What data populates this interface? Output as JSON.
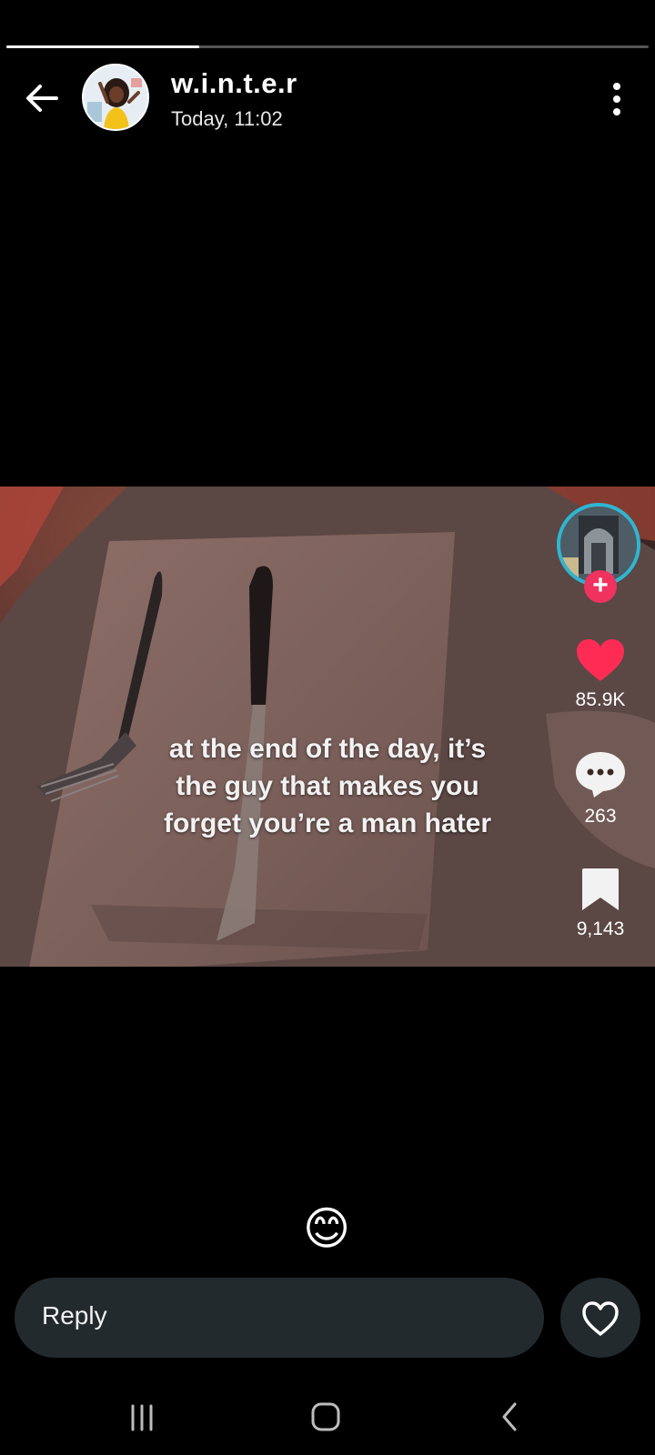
{
  "story": {
    "progress": 0.3
  },
  "header": {
    "username": "w.i.n.t.e.r",
    "timestamp": "Today, 11:02"
  },
  "media": {
    "caption_lines": [
      "at the end of the day, it’s",
      "the guy that makes you",
      "forget you’re a man hater"
    ],
    "likes": "85.9K",
    "comments": "263",
    "saves": "9,143",
    "follow_symbol": "+"
  },
  "reaction": {
    "emoji": "😊"
  },
  "reply": {
    "placeholder": "Reply"
  },
  "colors": {
    "background": "#000000",
    "reply_field": "#232a2e",
    "like_heart": "#fe2c55",
    "follow_plus": "#f0325f",
    "creator_ring": "#2fb6d1"
  },
  "icons": {
    "back": "arrow-left-icon",
    "menu": "more-vertical-icon",
    "like": "heart-icon",
    "comment": "comment-bubble-icon",
    "save": "bookmark-icon",
    "reply_like": "heart-outline-icon",
    "nav_recents": "recents-icon",
    "nav_home": "home-icon",
    "nav_back": "nav-back-icon"
  }
}
